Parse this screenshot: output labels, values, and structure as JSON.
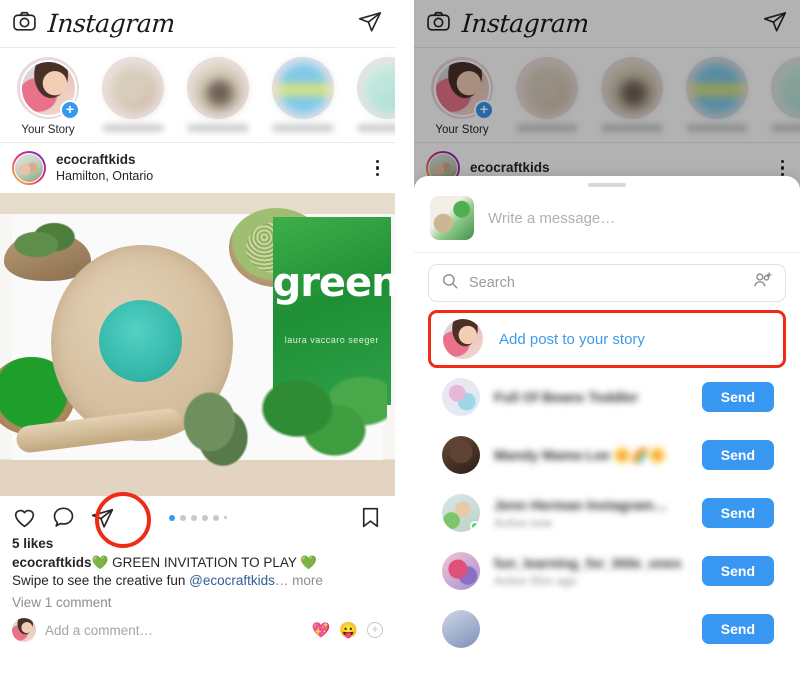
{
  "app": {
    "name": "Instagram"
  },
  "left_panel": {
    "header": {
      "camera_icon": "camera-icon",
      "logo": "Instagram",
      "share_icon": "share-paper-plane-icon"
    },
    "stories": {
      "items": [
        {
          "label": "Your Story",
          "has_plus": true,
          "blurred": false
        },
        {
          "label": "",
          "has_plus": false,
          "blurred": true
        },
        {
          "label": "",
          "has_plus": false,
          "blurred": true
        },
        {
          "label": "",
          "has_plus": false,
          "blurred": true
        },
        {
          "label": "",
          "has_plus": false,
          "blurred": true
        }
      ]
    },
    "post": {
      "username": "ecocraftkids",
      "location": "Hamilton, Ontario",
      "menu_icon": "more-options-icon",
      "image_alt": "green themed flat lay with wooden tray, herbs and green book",
      "image_book_title": "green",
      "image_book_author": "laura vaccaro seeger",
      "actions": {
        "like_icon": "heart-icon",
        "comment_icon": "comment-bubble-icon",
        "share_icon": "share-paper-plane-icon",
        "save_icon": "bookmark-icon"
      },
      "carousel": {
        "count": 5,
        "active_index": 0,
        "has_partial": true
      },
      "likes": "5 likes",
      "caption_user": "ecocraftkids",
      "caption_heart_left": "💚",
      "caption_main": " GREEN INVITATION TO PLAY ",
      "caption_heart_right": "💚",
      "caption_line2": "Swipe to see the creative fun ",
      "caption_mention": "@ecocraftkids",
      "caption_ellipsis": "…",
      "caption_more": " more",
      "view_comments": "View 1 comment",
      "add_comment_placeholder": "Add a comment…",
      "emoji_1": "💖",
      "emoji_2": "😛",
      "plus_icon": "add-sticker-icon"
    },
    "annotation": {
      "type": "red-circle-highlight",
      "target": "share-paper-plane-icon",
      "color": "#ef2b16"
    }
  },
  "right_panel": {
    "share_sheet": {
      "grabber": "drag-handle",
      "message": {
        "placeholder": "Write a message…",
        "thumb_alt": "post thumbnail"
      },
      "search": {
        "placeholder": "Search",
        "icon": "search-icon",
        "add_people_icon": "add-people-icon"
      },
      "add_to_story": {
        "label": "Add post to your story",
        "highlighted": true,
        "color": "#3f9ae8"
      },
      "contacts": [
        {
          "name": "Full Of Beans Toddler",
          "sub": "",
          "send": "Send",
          "online": false
        },
        {
          "name": "Mandy Mama Lee 🌼🌈🌼",
          "sub": "",
          "send": "Send",
          "online": false
        },
        {
          "name": "Jenn Herman Instagram…",
          "sub": "Active now",
          "send": "Send",
          "online": true
        },
        {
          "name": "fun_learning_for_little_ones",
          "sub": "Active 55m ago",
          "send": "Send",
          "online": false
        },
        {
          "name": "",
          "sub": "",
          "send": "Send",
          "online": false
        }
      ]
    },
    "annotation": {
      "type": "red-box-highlight",
      "target": "add-post-to-your-story-row",
      "color": "#ef2b16"
    }
  },
  "colors": {
    "accent_blue": "#3897f0",
    "link_blue": "#3f9ae8",
    "highlight_red": "#ef2b16",
    "text": "#262626",
    "muted": "#8e8e8e"
  }
}
